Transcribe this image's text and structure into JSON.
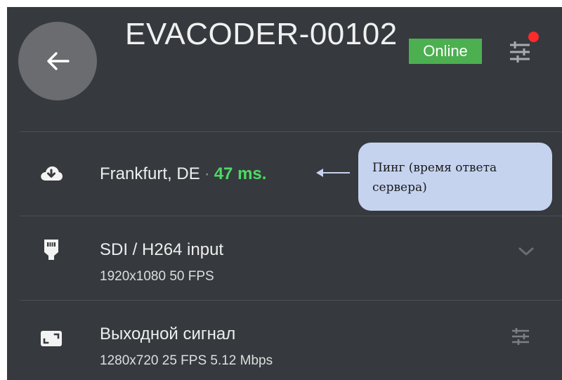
{
  "device": {
    "name": "EVACODER-00102",
    "status": "Online"
  },
  "icons": {
    "back": "arrow-left-icon",
    "settings": "sliders-icon",
    "cloud": "cloud-download-icon",
    "sdi": "sdi-connector-icon",
    "output": "screen-expand-icon",
    "chevron": "chevron-down-icon"
  },
  "server": {
    "location": "Frankfurt, DE",
    "separator": "·",
    "ping": "47 ms."
  },
  "input": {
    "title": "SDI / H264 input",
    "details": "1920x1080 50 FPS"
  },
  "output": {
    "title": "Выходной сигнал",
    "details": "1280x720 25 FPS 5.12 Mbps"
  },
  "annotation": {
    "text": "Пинг (время ответа сервера)"
  },
  "colors": {
    "panel_bg": "#363a3e",
    "online_badge": "#4caf50",
    "ping_green": "#4cd964",
    "notification_dot": "#ff2a2a",
    "callout_bg": "#c5d3ef"
  }
}
